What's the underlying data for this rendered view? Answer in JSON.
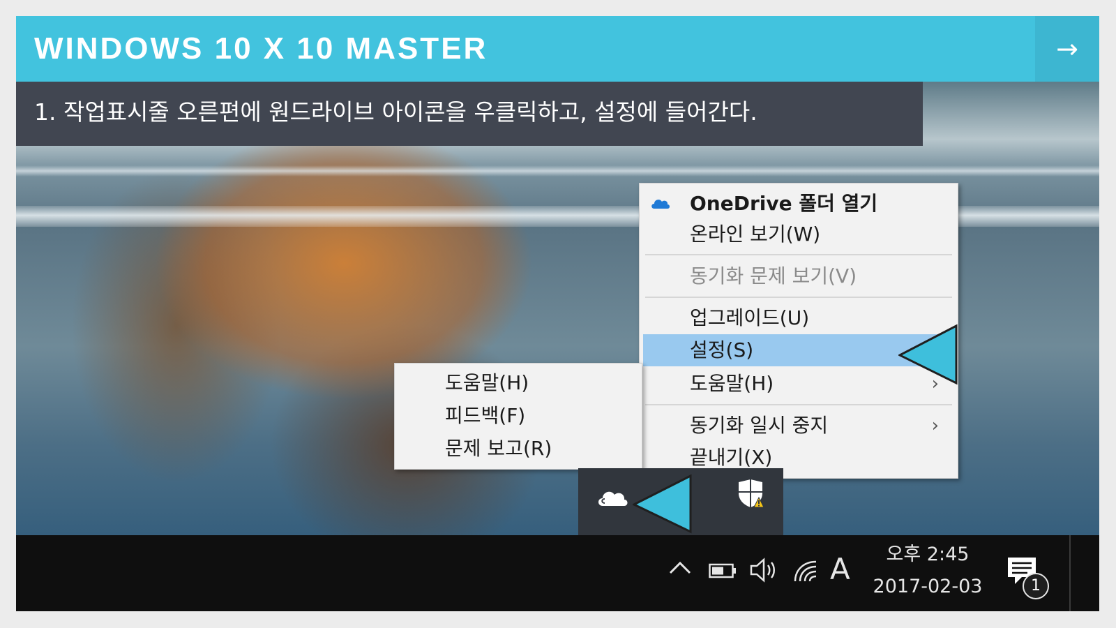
{
  "header": {
    "title": "WINDOWS 10 X 10 MASTER",
    "next_icon": "→"
  },
  "instruction": {
    "text": "1. 작업표시줄 오른편에 원드라이브 아이콘을 우클릭하고, 설정에 들어간다."
  },
  "context_menu": {
    "items": [
      {
        "label": "OneDrive 폴더 열기",
        "icon": "onedrive-cloud-icon",
        "style": "bold"
      },
      {
        "label": "온라인 보기(W)"
      },
      {
        "label": "동기화 문제 보기(V)",
        "disabled": true
      },
      {
        "label": "업그레이드(U)"
      },
      {
        "label": "설정(S)",
        "highlighted": true
      },
      {
        "label": "도움말(H)",
        "submenu": true
      },
      {
        "label": "동기화 일시 중지",
        "submenu": true
      },
      {
        "label": "끝내기(X)"
      }
    ],
    "chevron": "›"
  },
  "submenu": {
    "items": [
      {
        "label": "도움말(H)"
      },
      {
        "label": "피드백(F)"
      },
      {
        "label": "문제 보고(R)"
      }
    ]
  },
  "tray": {
    "icons": [
      "onedrive-cloud-icon",
      "windows-defender-warning-icon"
    ]
  },
  "taskbar": {
    "icons": [
      "show-hidden-icons-chevron",
      "battery-icon",
      "volume-icon",
      "wifi-icon"
    ],
    "ime_label": "A",
    "time": "오후 2:45",
    "date": "2017-02-03",
    "notification_count": "1"
  },
  "colors": {
    "accent": "#42c3de",
    "banner": "#414651",
    "highlight": "#99c9ef",
    "taskbar": "#0f0f0f"
  }
}
